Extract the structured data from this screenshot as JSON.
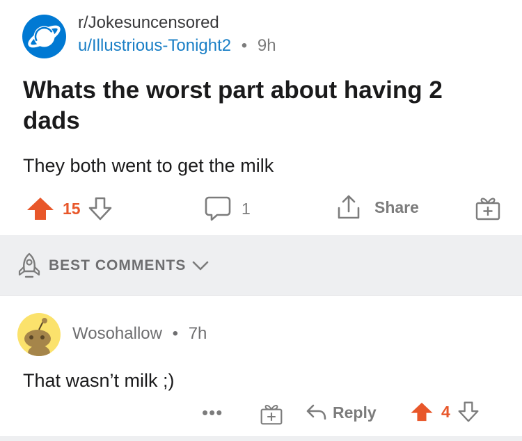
{
  "post": {
    "subreddit": "r/Jokesuncensored",
    "author": "u/Illustrious-Tonight2",
    "separator": "•",
    "age": "9h",
    "title": "Whats the worst part about having 2 dads",
    "body": "They both went to get the milk",
    "score": "15",
    "comment_count": "1",
    "share_label": "Share"
  },
  "comments_sort": {
    "label": "BEST COMMENTS"
  },
  "comment": {
    "author": "Wosohallow",
    "separator": "•",
    "age": "7h",
    "body": "That wasn’t milk ;)",
    "more_label": "•••",
    "reply_label": "Reply",
    "score": "4"
  },
  "colors": {
    "upvote": "#e8572a",
    "subreddit_avatar": "#0079d3",
    "username_link": "#1a7fc6",
    "comment_avatar": "#fbe26c",
    "band": "#eeeff1"
  }
}
